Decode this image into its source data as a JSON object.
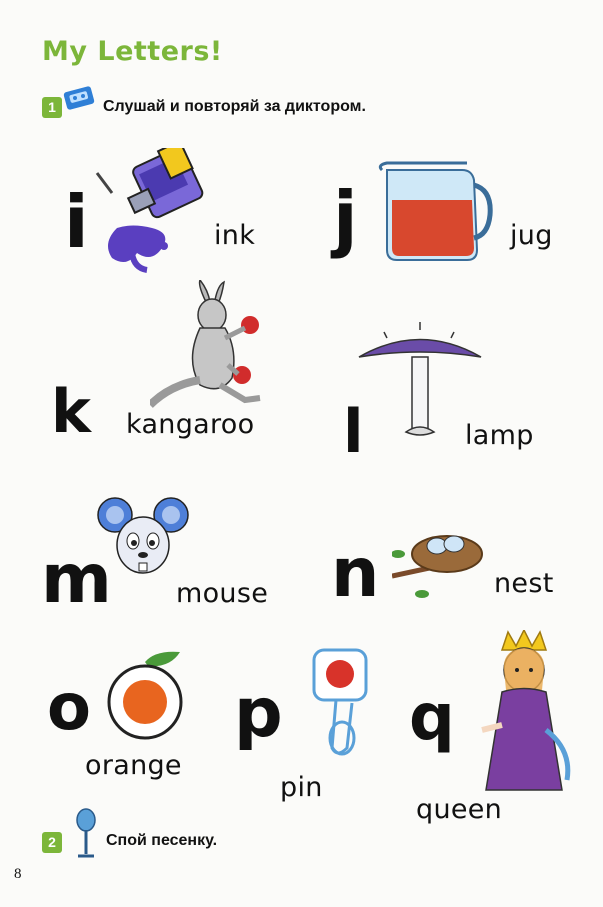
{
  "title": "My Letters!",
  "page_number": "8",
  "exercise1": {
    "number": "1",
    "instruction": "Слушай и повторяй за диктором.",
    "icon": "audio-cassette-icon"
  },
  "exercise2": {
    "number": "2",
    "instruction": "Спой песенку.",
    "icon": "microphone-icon"
  },
  "letters": [
    {
      "letter": "i",
      "word": "ink",
      "picture": "ink-bottle"
    },
    {
      "letter": "j",
      "word": "jug",
      "picture": "jug"
    },
    {
      "letter": "k",
      "word": "kangaroo",
      "picture": "kangaroo"
    },
    {
      "letter": "l",
      "word": "lamp",
      "picture": "lamp"
    },
    {
      "letter": "m",
      "word": "mouse",
      "picture": "mouse"
    },
    {
      "letter": "n",
      "word": "nest",
      "picture": "nest"
    },
    {
      "letter": "o",
      "word": "orange",
      "picture": "orange"
    },
    {
      "letter": "p",
      "word": "pin",
      "picture": "pin"
    },
    {
      "letter": "q",
      "word": "queen",
      "picture": "queen"
    }
  ],
  "colors": {
    "title_green": "#7cb63a",
    "badge_green": "#7cb63a",
    "ink_purple": "#5a3fc0",
    "jug_red": "#d8482e",
    "lamp_purple": "#6a4ca8",
    "mouse_blue": "#4e7fd8",
    "orange": "#e8651f",
    "queen_purple": "#7a3fa0"
  }
}
